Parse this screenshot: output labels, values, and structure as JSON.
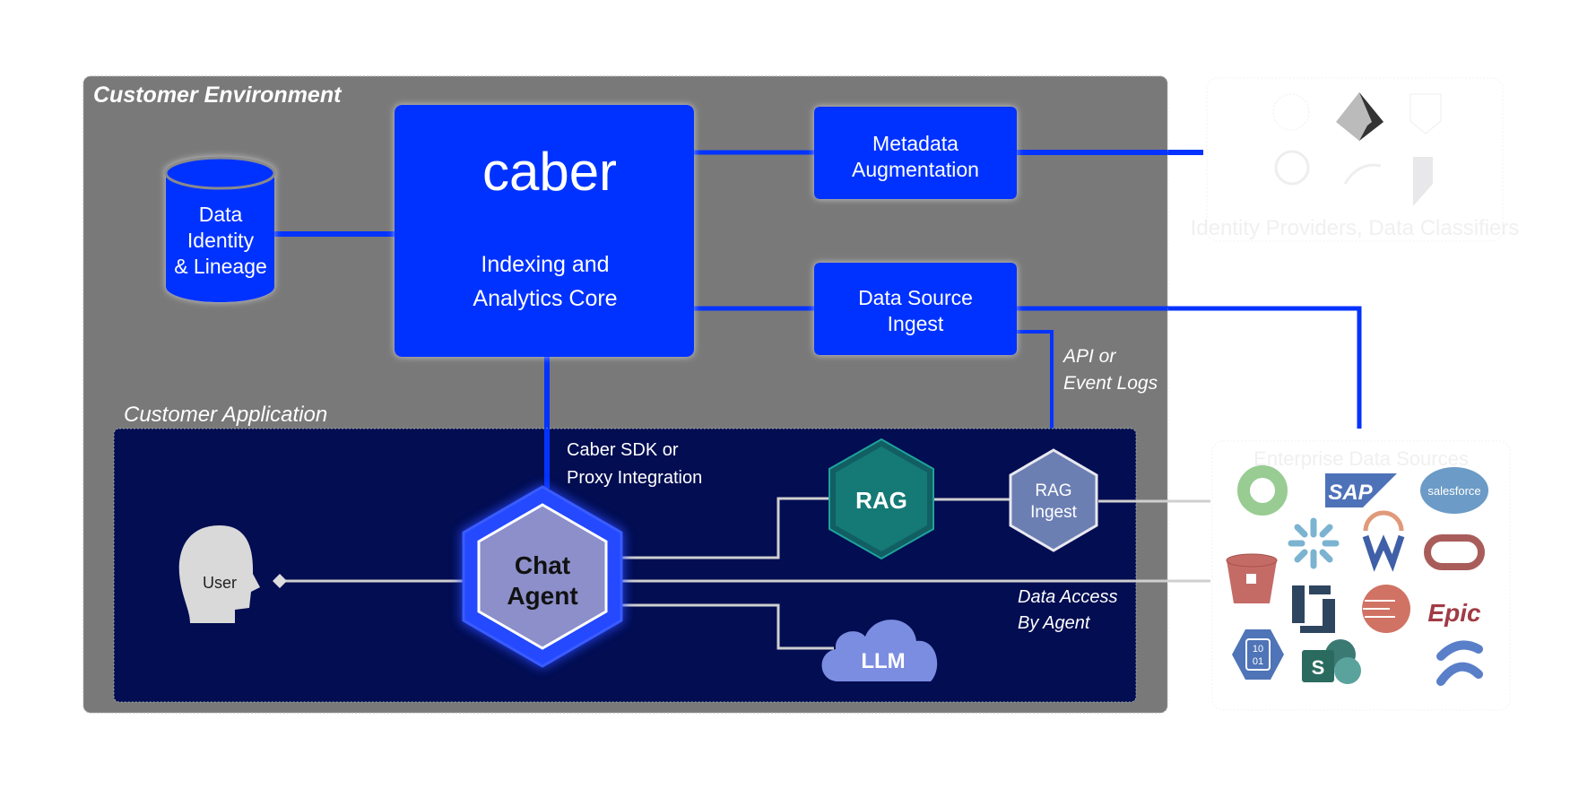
{
  "environment": {
    "title": "Customer Environment"
  },
  "application": {
    "title": "Customer Application"
  },
  "data_store": {
    "lines": [
      "Data",
      "Identity",
      "& Lineage"
    ]
  },
  "core": {
    "logo": "caber",
    "lines": [
      "Indexing and",
      "Analytics Core"
    ]
  },
  "metadata": {
    "lines": [
      "Metadata",
      "Augmentation"
    ]
  },
  "ingest": {
    "lines": [
      "Data Source",
      "Ingest"
    ]
  },
  "api_label": {
    "lines": [
      "API or",
      "Event Logs"
    ]
  },
  "sdk_label": {
    "lines": [
      "Caber SDK or",
      "Proxy Integration"
    ]
  },
  "data_access_label": {
    "lines": [
      "Data Access",
      "By Agent"
    ]
  },
  "user": {
    "label": "User"
  },
  "chat_agent": {
    "lines": [
      "Chat",
      "Agent"
    ]
  },
  "rag": {
    "label": "RAG"
  },
  "rag_ingest": {
    "lines": [
      "RAG",
      "Ingest"
    ]
  },
  "llm": {
    "label": "LLM"
  },
  "identity_providers": {
    "label": "Identity Providers, Data Classifiers"
  },
  "enterprise_sources": {
    "label": "Enterprise Data Sources",
    "logos": [
      "SAP",
      "salesforce",
      "Epic",
      "S",
      "10",
      "01"
    ]
  },
  "colors": {
    "caber_blue": "#0433ff",
    "environment_gray": "#797979",
    "application_navy": "#020d52",
    "agent_purple": "#8c8fc9",
    "rag_teal": "#17807b",
    "connector_gray": "#cfcfcf"
  }
}
